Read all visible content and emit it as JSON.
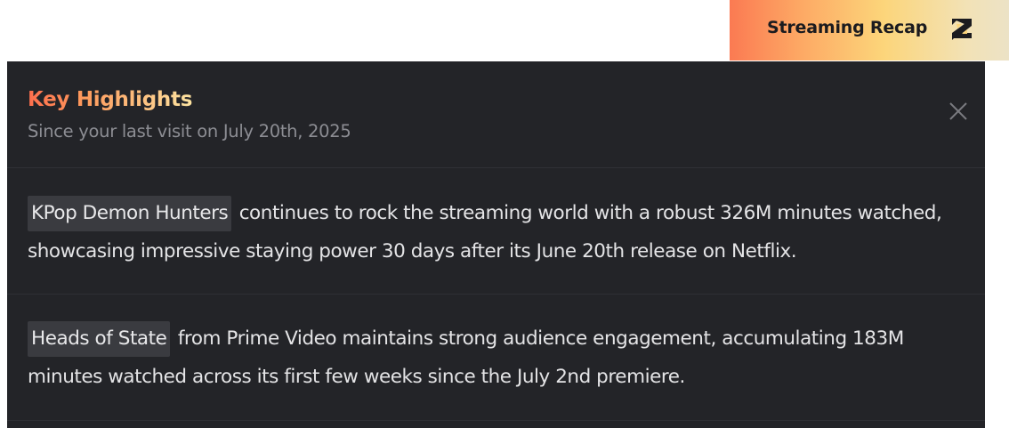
{
  "recap_tab": {
    "label": "Streaming Recap",
    "logo_icon": "brand-logo-icon"
  },
  "panel": {
    "title": "Key Highlights",
    "subtitle": "Since your last visit on July 20th, 2025",
    "close_icon": "close-icon"
  },
  "highlights": [
    {
      "title": "KPop Demon Hunters",
      "text": "continues to rock the streaming world with a robust 326M minutes watched, showcasing impressive staying power 30 days after its June 20th release on Netflix."
    },
    {
      "title": "Heads of State",
      "text": "from Prime Video maintains strong audience engagement, accumulating 183M minutes watched across its first few weeks since the July 2nd premiere."
    }
  ],
  "colors": {
    "panel_bg": "#232428",
    "accent_orange": "#fd6e4d",
    "accent_yellow": "#fde3a0",
    "chip_bg": "#3a3b40"
  }
}
